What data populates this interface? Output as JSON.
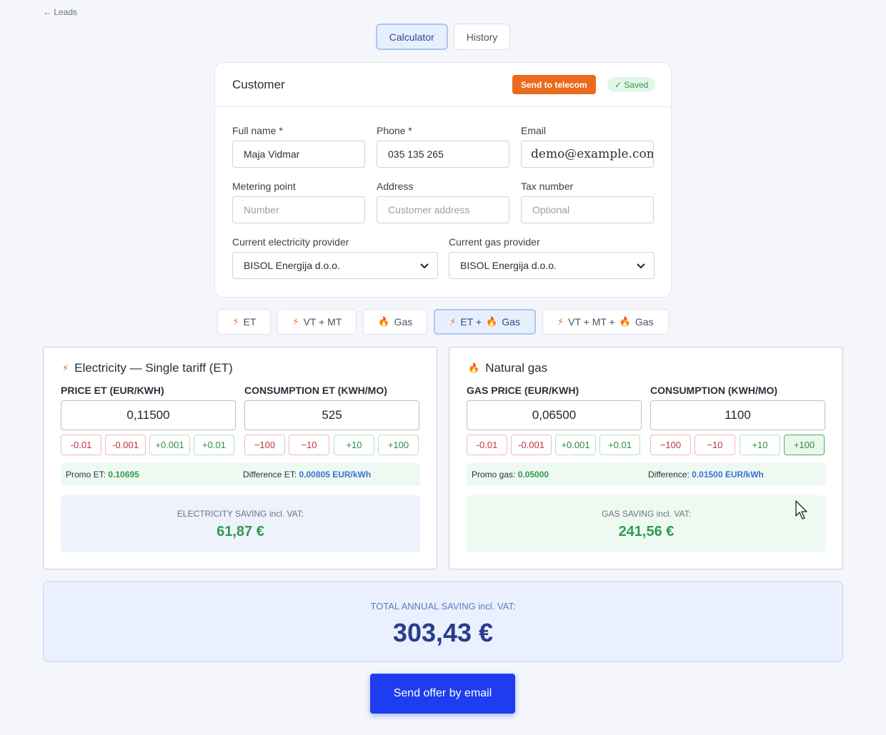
{
  "nav": {
    "back_label": "← Leads"
  },
  "top_tabs": [
    {
      "label": "Calculator",
      "active": true
    },
    {
      "label": "History",
      "active": false
    }
  ],
  "customer": {
    "title": "Customer",
    "send_label": "Send to telecom",
    "saved_label": "✓ Saved",
    "fields": {
      "full_name": {
        "label": "Full name *",
        "value": "Maja Vidmar"
      },
      "phone": {
        "label": "Phone *",
        "value": "035 135 265"
      },
      "email": {
        "label": "Email",
        "value": "demo@example.com"
      },
      "metering": {
        "label": "Metering point",
        "placeholder": "Number"
      },
      "address": {
        "label": "Address",
        "placeholder": "Customer address"
      },
      "tax": {
        "label": "Tax number",
        "placeholder": "Optional"
      },
      "elec_provider": {
        "label": "Current electricity provider",
        "value": "BISOL Energija d.o.o."
      },
      "gas_provider": {
        "label": "Current gas provider",
        "value": "BISOL Energija d.o.o."
      }
    }
  },
  "mode_tabs": [
    {
      "label": "ET",
      "icons": [
        "bolt"
      ],
      "active": false
    },
    {
      "label": "VT + MT",
      "icons": [
        "bolt"
      ],
      "active": false
    },
    {
      "label": "Gas",
      "icons": [
        "flame"
      ],
      "active": false
    },
    {
      "label_a": "ET +",
      "label_b": "Gas",
      "icons": [
        "bolt",
        "flame"
      ],
      "active": true
    },
    {
      "label_a": "VT + MT +",
      "label_b": "Gas",
      "icons": [
        "bolt",
        "flame"
      ],
      "active": false
    }
  ],
  "electricity": {
    "icon": "bolt-icon",
    "title": "Electricity — Single tariff (ET)",
    "price_label": "PRICE ET (EUR/KWH)",
    "price_value": "0,11500",
    "cons_label": "CONSUMPTION ET (KWH/MO)",
    "cons_value": "525",
    "price_steps": [
      "-0.01",
      "-0.001",
      "+0.001",
      "+0.01"
    ],
    "cons_steps": [
      "−100",
      "−10",
      "+10",
      "+100"
    ],
    "promo_label": "Promo ET:",
    "promo_value": "0.10695",
    "diff_label": "Difference ET:",
    "diff_value": "0.00805 EUR/kWh",
    "saving_label": "ELECTRICITY SAVING incl. VAT:",
    "saving_value": "61,87 €"
  },
  "gas": {
    "icon": "flame-icon",
    "title": "Natural gas",
    "price_label": "GAS PRICE (EUR/KWH)",
    "price_value": "0,06500",
    "cons_label": "CONSUMPTION (KWH/MO)",
    "cons_value": "1100",
    "price_steps": [
      "-0.01",
      "-0.001",
      "+0.001",
      "+0.01"
    ],
    "cons_steps": [
      "−100",
      "−10",
      "+10",
      "+100"
    ],
    "promo_label": "Promo gas:",
    "promo_value": "0.05000",
    "diff_label": "Difference:",
    "diff_value": "0.01500 EUR/kWh",
    "saving_label": "GAS SAVING incl. VAT:",
    "saving_value": "241,56 €"
  },
  "total": {
    "label": "TOTAL ANNUAL SAVING incl. VAT:",
    "value": "303,43 €"
  },
  "email_button": "Send offer by email",
  "colors": {
    "accent_orange": "#ec6a1c",
    "primary_blue": "#1e3df0",
    "success_green": "#2f9b4d",
    "info_blue": "#3a6fd8"
  }
}
